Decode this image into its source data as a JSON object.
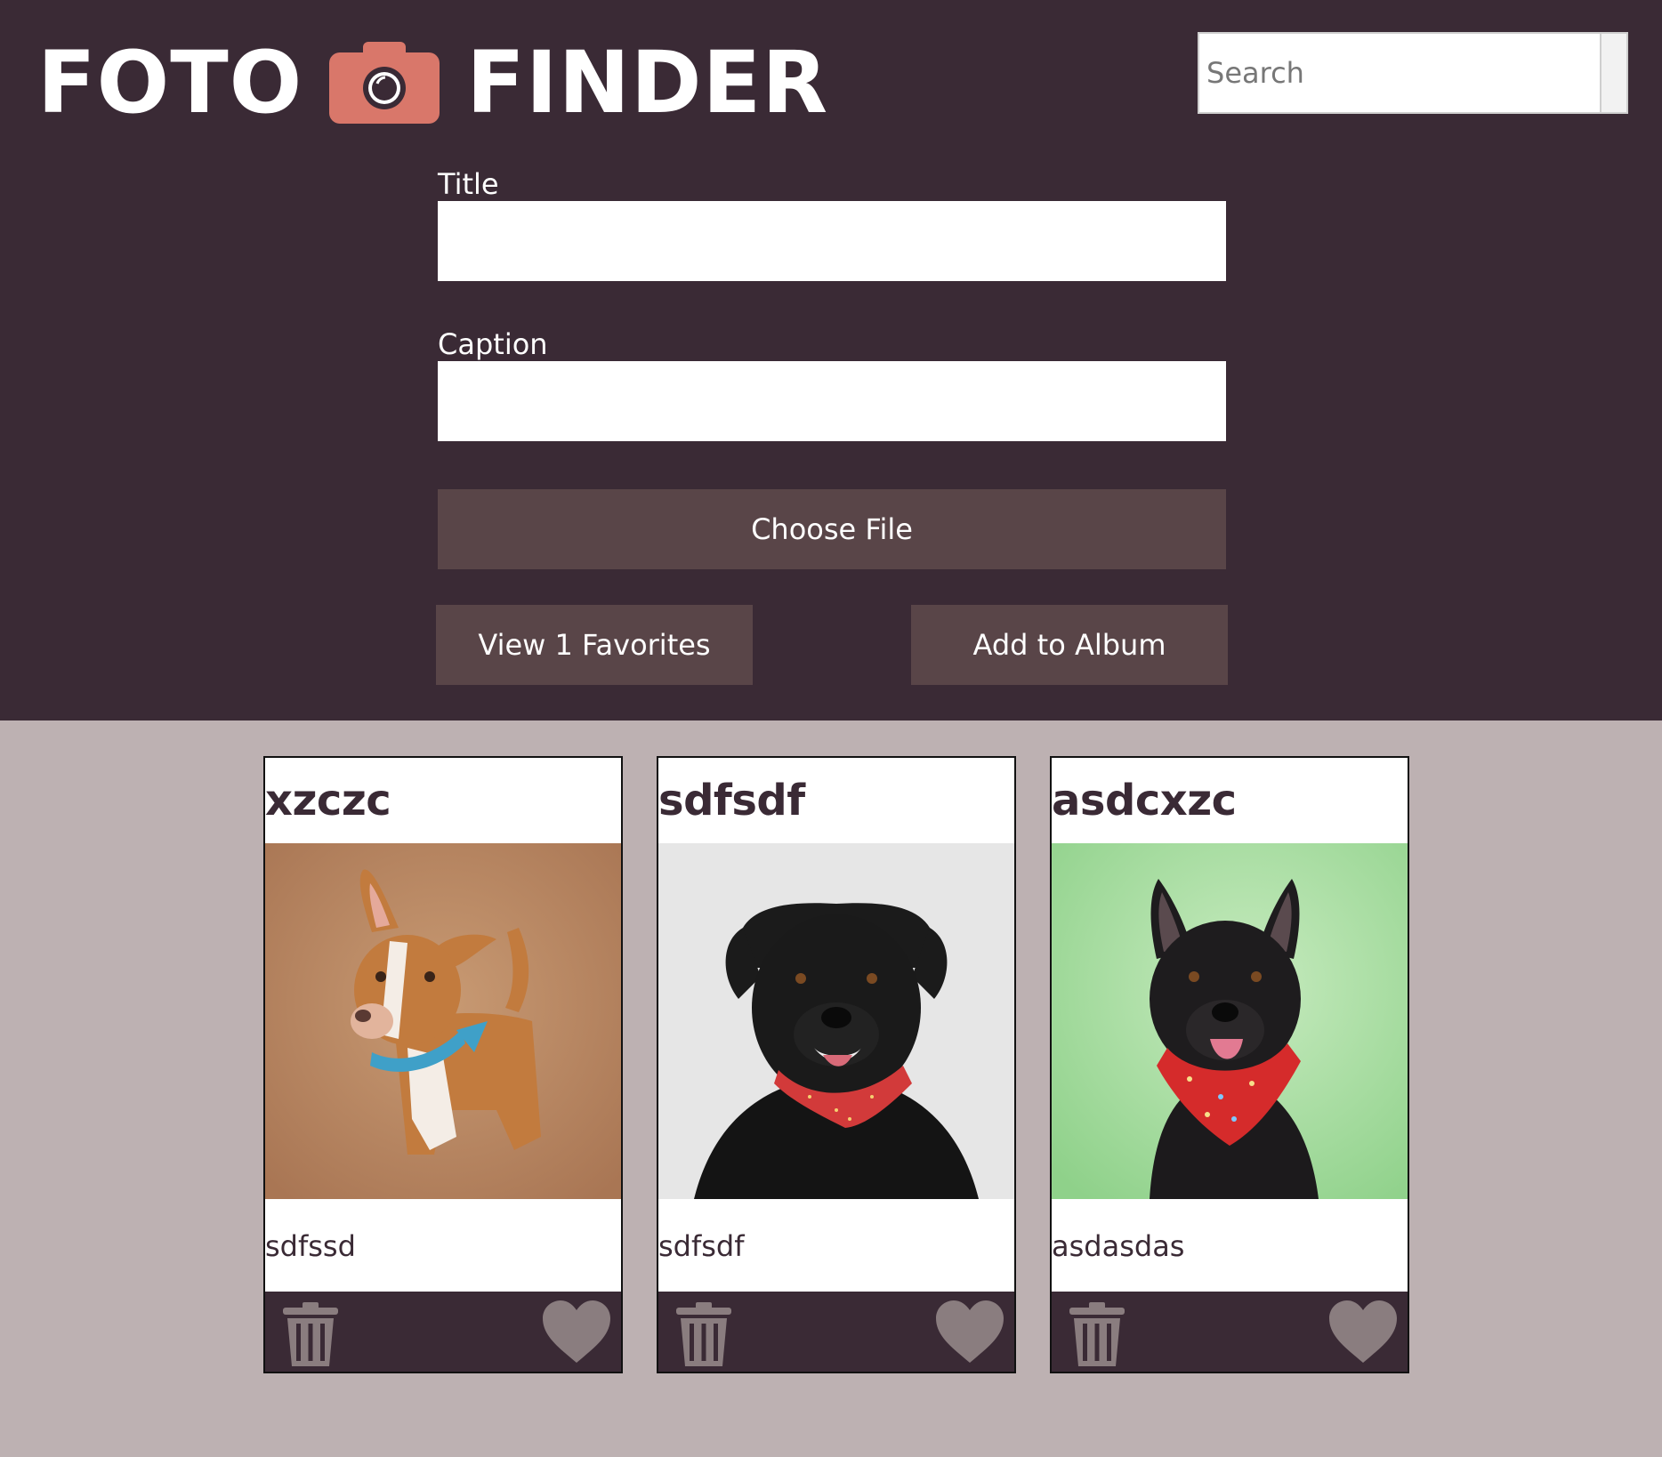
{
  "app": {
    "title_left": "FOTO",
    "title_right": "FINDER",
    "logo_icon": "camera-icon",
    "colors": {
      "header_bg": "#3a2a35",
      "page_bg": "#bdb1b2",
      "button_bg": "#594548",
      "camera_accent": "#d9776a",
      "icon_gray": "#8a7d7f"
    }
  },
  "search": {
    "placeholder": "Search",
    "value": ""
  },
  "form": {
    "title_label": "Title",
    "title_value": "",
    "caption_label": "Caption",
    "caption_value": "",
    "choose_file_label": "Choose File",
    "favorites_label": "View 1 Favorites",
    "add_album_label": "Add to Album"
  },
  "cards": [
    {
      "title": "xzczc",
      "caption": "sdfssd",
      "photo_desc": "tan-white-dog-blue-bandana",
      "trash_icon": "trash-icon",
      "heart_icon": "heart-icon"
    },
    {
      "title": "sdfsdf",
      "caption": "sdfsdf",
      "photo_desc": "black-dog-red-bandana",
      "trash_icon": "trash-icon",
      "heart_icon": "heart-icon"
    },
    {
      "title": "asdcxzc",
      "caption": "asdasdas",
      "photo_desc": "black-dog-red-bandana-green-bg",
      "trash_icon": "trash-icon",
      "heart_icon": "heart-icon"
    }
  ]
}
